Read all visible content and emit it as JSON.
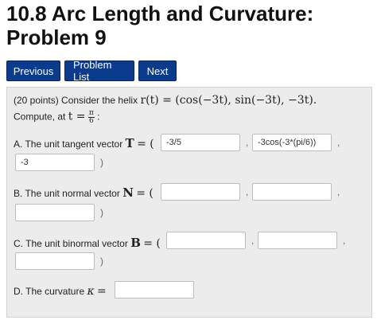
{
  "page": {
    "title_line1": "10.8 Arc Length and Curvature:",
    "title_line2": "Problem 9"
  },
  "nav": {
    "previous": "Previous",
    "problem_list": "Problem List",
    "next": "Next"
  },
  "problem": {
    "intro_prefix": "(20 points) Consider the helix",
    "r_of_t": "r(t) = (cos(−3t), sin(−3t), −3t).",
    "compute_prefix": "Compute, at",
    "t_eq": "t =",
    "t_num": "π",
    "t_den": "6",
    "t_colon": ":",
    "a_label": "A. The unit tangent vector",
    "a_symbol": "T",
    "a_eq": "= (",
    "a_values": [
      "-3/5",
      "-3cos(-3*(pi/6))",
      "-3"
    ],
    "b_label": "B. The unit normal vector",
    "b_symbol": "N",
    "b_eq": "= (",
    "b_values": [
      "",
      "",
      ""
    ],
    "c_label": "C. The unit binormal vector",
    "c_symbol": "B",
    "c_eq": "= (",
    "c_values": [
      "",
      "",
      ""
    ],
    "d_label": "D. The curvature",
    "d_symbol": "κ",
    "d_eq": "=",
    "d_value": "",
    "comma": ",",
    "close_paren": ")"
  }
}
